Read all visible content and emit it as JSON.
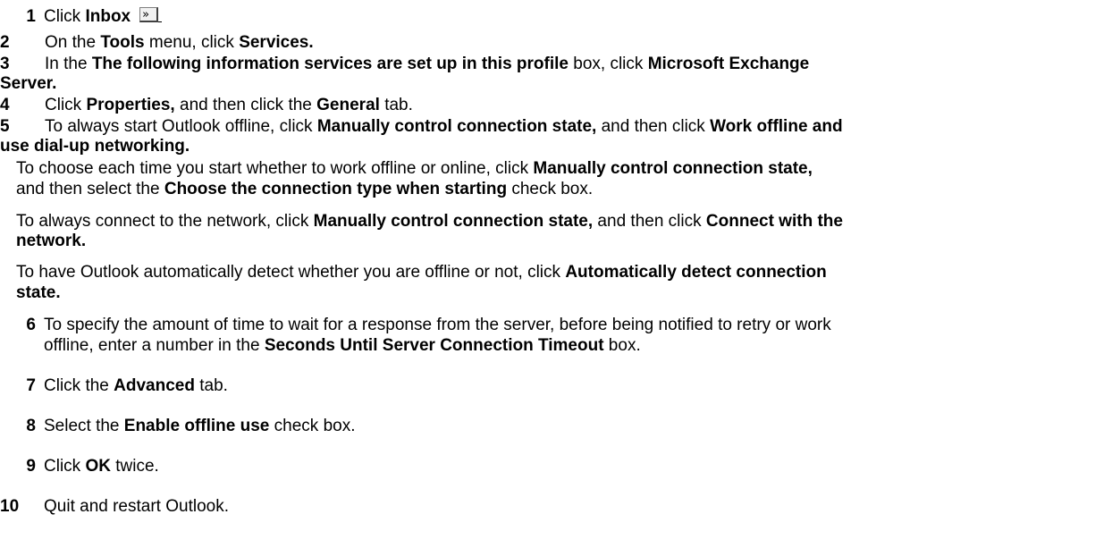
{
  "steps": [
    {
      "num": "1",
      "parts": [
        "Click ",
        "Inbox"
      ],
      "icon": "inbox-chevron-icon"
    },
    {
      "num": "2",
      "parts": [
        "On the ",
        "Tools",
        " menu, click ",
        "Services."
      ]
    },
    {
      "num": "3",
      "parts": [
        "In the ",
        "The following information services are set up in this profile",
        " box, click ",
        "Microsoft Exchange"
      ],
      "wrap": "Server."
    },
    {
      "num": "4",
      "parts": [
        "Click ",
        "Properties,",
        " and then click the ",
        "General",
        " tab."
      ]
    },
    {
      "num": "5",
      "parts": [
        "To always start Outlook offline, click ",
        "Manually control connection state,",
        " and then click ",
        "Work offline and"
      ],
      "wrap": "use dial-up networking."
    },
    {
      "num": "6",
      "lines": [
        [
          "To specify the amount of time to wait for a response from the server, before being notified to retry or work"
        ],
        [
          "offline, enter a number in the ",
          "Seconds Until Server Connection Timeout",
          " box."
        ]
      ]
    },
    {
      "num": "7",
      "parts": [
        "Click the ",
        "Advanced",
        " tab."
      ]
    },
    {
      "num": "8",
      "parts": [
        "Select the ",
        "Enable offline use",
        " check box."
      ]
    },
    {
      "num": "9",
      "parts": [
        "Click ",
        "OK",
        " twice."
      ]
    },
    {
      "num": "10",
      "parts": [
        "Quit and restart Outlook."
      ]
    }
  ],
  "options": [
    {
      "lines": [
        [
          "To choose each time you start whether to work offline or online, click ",
          "Manually control connection state,"
        ],
        [
          "and then select the ",
          "Choose the connection type when starting",
          " check box."
        ]
      ]
    },
    {
      "lines": [
        [
          "To always connect to the network, click ",
          "Manually control connection state,",
          " and then click ",
          "Connect with the"
        ],
        [
          "",
          "network."
        ]
      ]
    },
    {
      "lines": [
        [
          "To have Outlook automatically detect whether you are offline or not, click ",
          "Automatically detect connection"
        ],
        [
          "",
          "state."
        ]
      ]
    }
  ]
}
